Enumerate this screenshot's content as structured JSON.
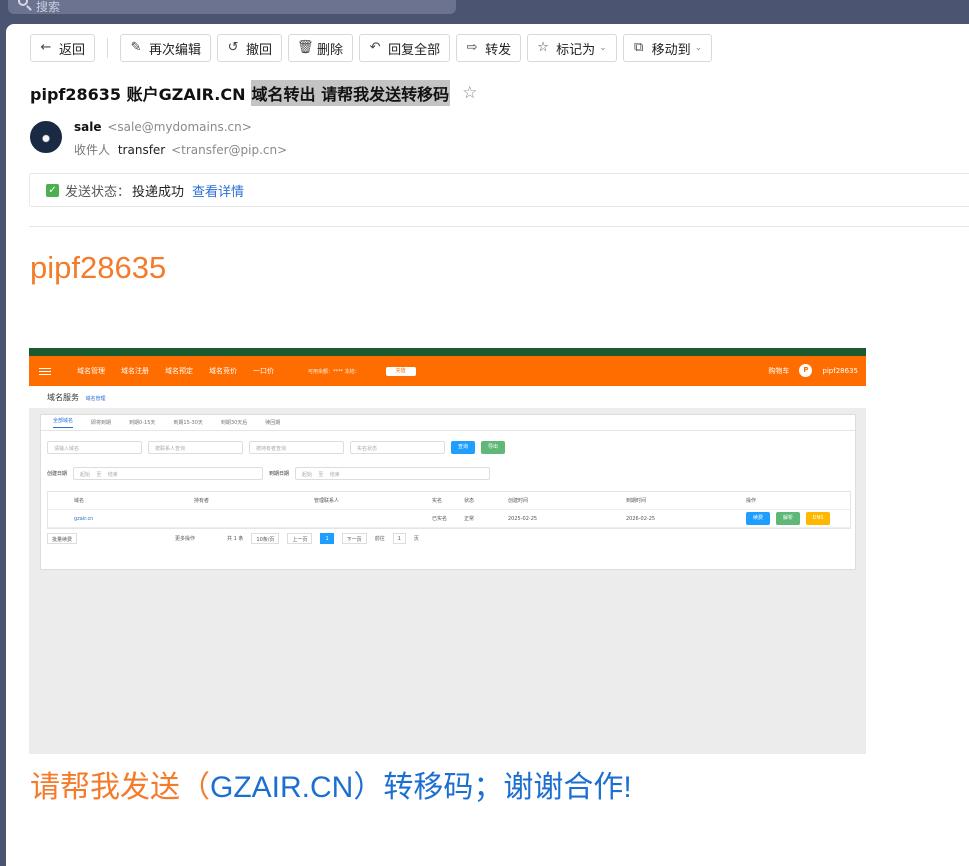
{
  "search": {
    "placeholder": "搜索"
  },
  "toolbar": {
    "back": "返回",
    "edit_again": "再次编辑",
    "recall": "撤回",
    "delete": "删除",
    "reply_all": "回复全部",
    "forward": "转发",
    "mark_as": "标记为",
    "move_to": "移动到"
  },
  "mail": {
    "subject_prefix": "pipf28635 账户GZAIR.CN",
    "subject_highlight": "域名转出 请帮我发送转移码",
    "sender_name": "sale",
    "sender_addr": "<sale@mydomains.cn>",
    "recipient_label": "收件人",
    "recipient_name": "transfer",
    "recipient_addr": "<transfer@pip.cn>",
    "status_label": "发送状态：",
    "status_value": "投递成功",
    "status_link": "查看详情",
    "heading": "pipf28635",
    "closing_part1": "请帮我发送（",
    "closing_domain": "GZAIR.CN",
    "closing_part2": "）转移码；谢谢合作!"
  },
  "shot": {
    "nav_items": [
      "域名管理",
      "域名注册",
      "域名预定",
      "域名竞价",
      "一口价"
    ],
    "balance": "可用余额：****   冻结：",
    "recharge": "充值",
    "cart": "购物车",
    "avatar_letter": "P",
    "username": "pipf28635",
    "crumb_title": "域名服务",
    "crumb_sub": "域名管理",
    "tabs": [
      "全部域名",
      "即将到期",
      "到期0-15天",
      "到期15-30天",
      "到期30天后",
      "赎回期"
    ],
    "filter_inputs": [
      "请输入域名",
      "按联系人查询",
      "按持有者查询",
      "实名状态"
    ],
    "query_btn": "查询",
    "export_btn": "导出",
    "created_label": "创建日期",
    "expire_label": "到期日期",
    "start": "起始",
    "to": "至",
    "end": "结束",
    "columns": [
      "域名",
      "持有者",
      "管理联系人",
      "实名",
      "状态",
      "创建时间",
      "到期时间",
      "操作"
    ],
    "row": {
      "domain": "gzair.cn",
      "realname": "已实名",
      "state": "正常",
      "created": "2025-02-25",
      "expires": "2026-02-25"
    },
    "actions": [
      "续费",
      "解析",
      "DNS"
    ],
    "batch": "批量续费",
    "more": "更多操作",
    "total": "共 1 条",
    "per_page": "10条/页",
    "prev": "上一页",
    "page": "1",
    "next": "下一页",
    "goto": "前往",
    "goto_page": "1",
    "page_unit": "页"
  }
}
